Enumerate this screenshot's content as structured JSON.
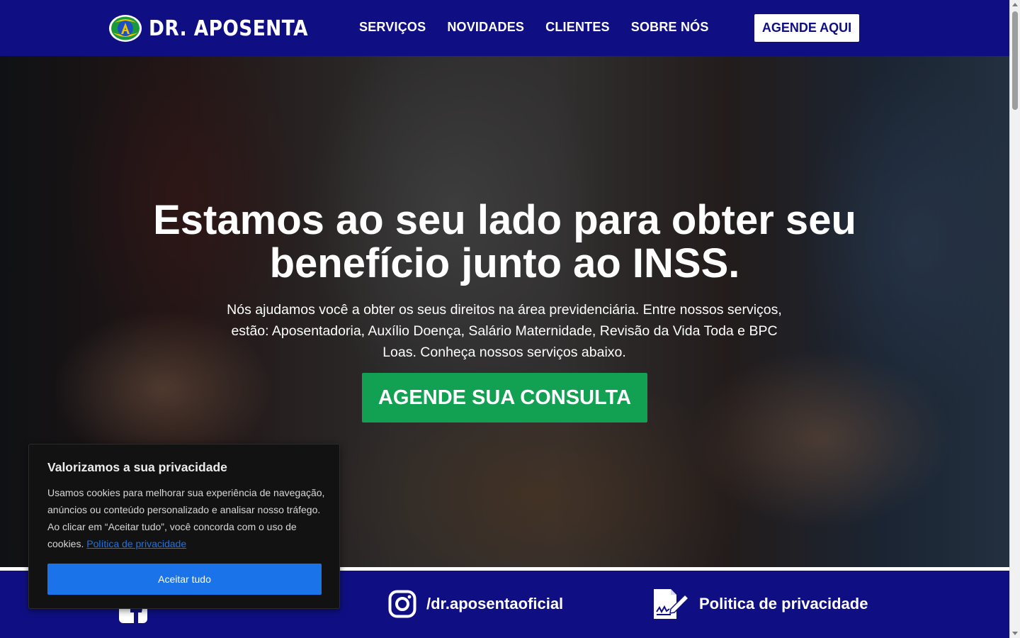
{
  "header": {
    "logo_text": "DR. APOSENTA",
    "nav": [
      {
        "label": "SERVIÇOS"
      },
      {
        "label": "NOVIDADES"
      },
      {
        "label": "CLIENTES"
      },
      {
        "label": "SOBRE NÓS"
      }
    ],
    "cta_label": "AGENDE AQUI"
  },
  "hero": {
    "title": "Estamos ao seu lado para obter seu benefício junto ao INSS.",
    "subtitle": "Nós ajudamos você a obter os seus direitos na área previdenciária. Entre nossos serviços, estão: Aposentadoria, Auxílio Doença, Salário Maternidade, Revisão da Vida Toda e BPC Loas. Conheça nossos serviços abaixo.",
    "cta_label": "AGENDE SUA CONSULTA"
  },
  "footer": {
    "instagram_label": "/dr.aposentaoficial",
    "privacy_label": "Politica de privacidade",
    "icons": [
      "facebook-icon",
      "instagram-icon",
      "privacy-document-icon"
    ]
  },
  "cookie_banner": {
    "title": "Valorizamos a sua privacidade",
    "text": "Usamos cookies para melhorar sua experiência de navegação, anúncios ou conteúdo personalizado e analisar nosso tráfego. Ao clicar em “Aceitar tudo”, você concorda com o uso de cookies.",
    "link_label": "Política de privacidade",
    "accept_label": "Aceitar tudo"
  },
  "colors": {
    "brand_navy": "#0f0f83",
    "cta_green": "#12a153",
    "cookie_blue": "#1a73e8",
    "white": "#ffffff"
  }
}
